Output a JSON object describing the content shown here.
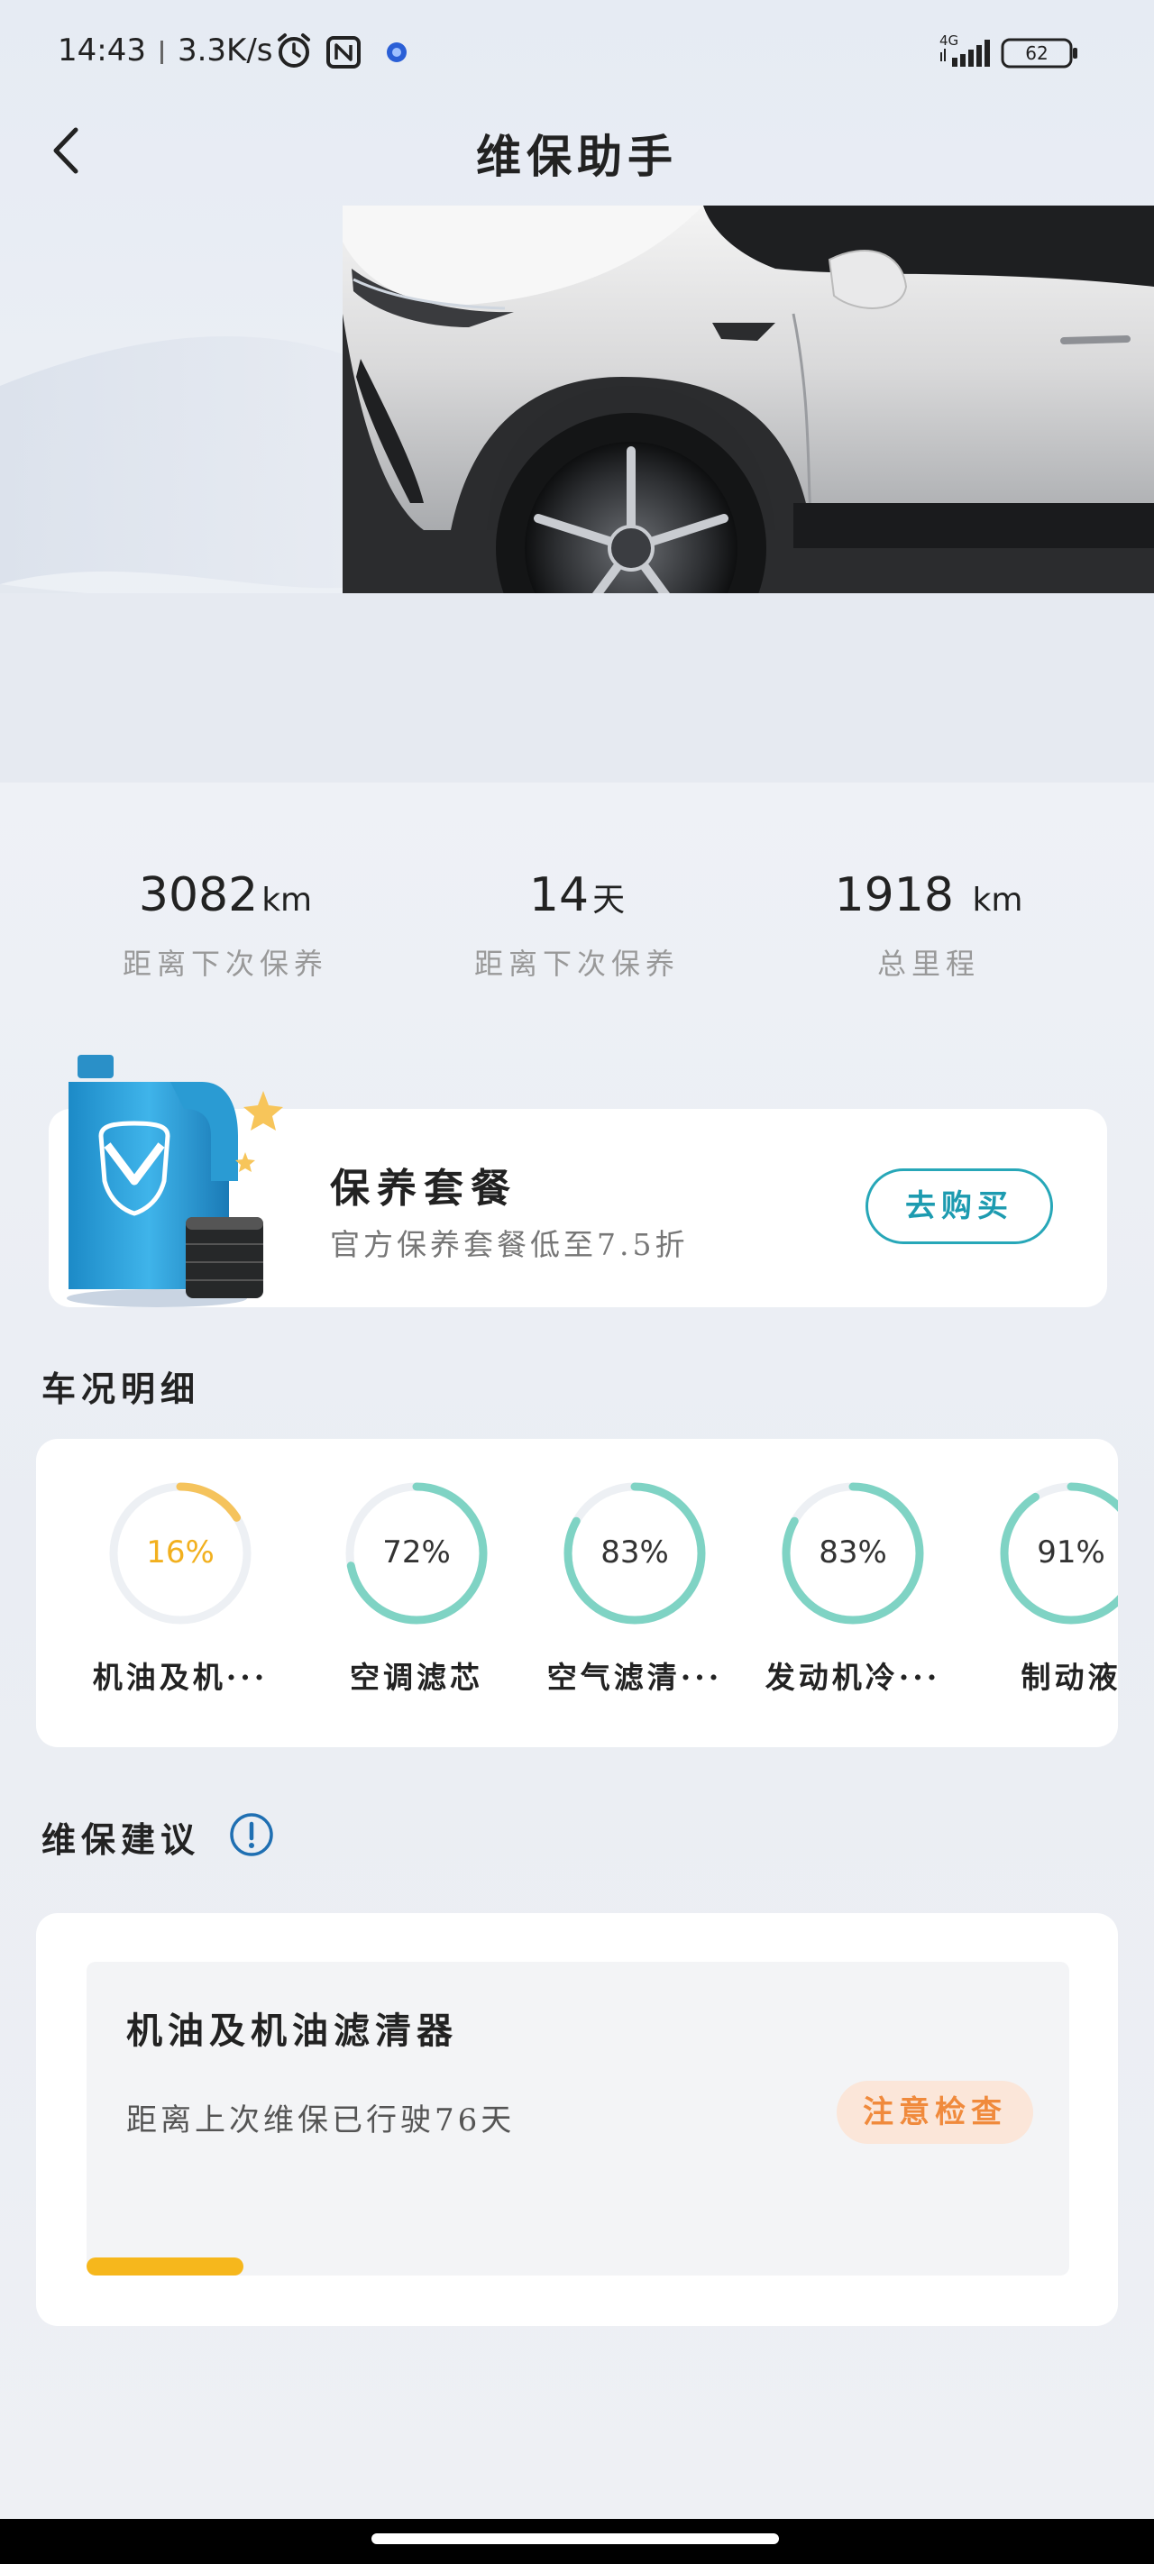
{
  "status_bar": {
    "time": "14:43",
    "net_speed": "3.3K/s",
    "network": "4G",
    "battery": "62"
  },
  "header": {
    "title": "维保助手"
  },
  "stats": [
    {
      "value": "3082",
      "unit": "km",
      "label": "距离下次保养"
    },
    {
      "value": "14",
      "unit": "天",
      "label": "距离下次保养"
    },
    {
      "value": "1918 ",
      "unit": "km",
      "label": "总里程"
    }
  ],
  "package": {
    "title": "保养套餐",
    "subtitle": "官方保养套餐低至7.5折",
    "button": "去购买"
  },
  "details": {
    "title": "车况明细",
    "items": [
      {
        "percent": "16%",
        "value": 0.16,
        "label": "机油及机···",
        "color": "#f5c35c"
      },
      {
        "percent": "72%",
        "value": 0.72,
        "label": "空调滤芯",
        "color": "#7fd3c4"
      },
      {
        "percent": "83%",
        "value": 0.83,
        "label": "空气滤清···",
        "color": "#7fd3c4"
      },
      {
        "percent": "83%",
        "value": 0.83,
        "label": "发动机冷···",
        "color": "#7fd3c4"
      },
      {
        "percent": "91%",
        "value": 0.91,
        "label": "制动液",
        "color": "#7fd3c4"
      }
    ]
  },
  "suggestion": {
    "title": "维保建议",
    "card": {
      "title": "机油及机油滤清器",
      "desc": "距离上次维保已行驶76天",
      "badge": "注意检查",
      "progress": 0.16
    }
  },
  "colors": {
    "accent_teal": "#27a7b8",
    "warning_orange": "#f08a3c",
    "warning_yellow": "#f6b71c",
    "gauge_track": "#edf0f4"
  }
}
